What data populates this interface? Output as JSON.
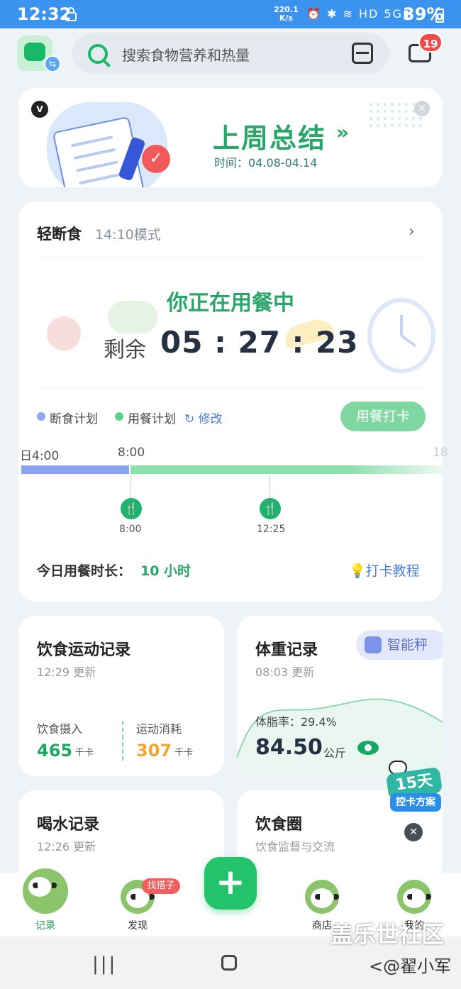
{
  "status": {
    "time": "12:32",
    "speed": "220.1",
    "speed_unit": "K/s",
    "icons": "⏰ ✱ ≋ HD 5G▮",
    "battery": "39%"
  },
  "header": {
    "search_placeholder": "搜索食物营养和热量",
    "mail_badge": "19"
  },
  "summary": {
    "title": "上周总结",
    "arrow": "»",
    "period": "时间：04.08-04.14"
  },
  "fasting": {
    "title": "轻断食",
    "mode": "14:10模式",
    "state": "你正在用餐中",
    "remain_label": "剩余",
    "timer": "05 : 27 : 23",
    "legend_fast": "断食计划",
    "legend_eat": "用餐计划",
    "modify": "修改",
    "checkin_button": "用餐打卡",
    "ticks": [
      "日4:00",
      "8:00",
      "18"
    ],
    "meals": [
      "8:00",
      "12:25"
    ],
    "duration_label": "今日用餐时长：",
    "duration_value": "10 小时",
    "tutorial": "打卡教程"
  },
  "diet": {
    "title": "饮食运动记录",
    "updated": "12:29 更新",
    "intake_label": "饮食摄入",
    "intake_value": "465",
    "intake_unit": "千卡",
    "burn_label": "运动消耗",
    "burn_value": "307",
    "burn_unit": "千卡"
  },
  "weight": {
    "title": "体重记录",
    "updated": "08:03 更新",
    "scale": "智能秤",
    "fat": "体脂率：29.4%",
    "value": "84.50",
    "unit": "公斤"
  },
  "water": {
    "title": "喝水记录",
    "updated": "12:26 更新"
  },
  "circle": {
    "title": "饮食圈",
    "subtitle": "饮食监督与交流"
  },
  "promo": {
    "days": "15天",
    "plan": "控卡方案"
  },
  "nav": {
    "items": [
      "记录",
      "发现",
      "",
      "商店",
      "我的"
    ],
    "tag": "找搭子",
    "plus": "+"
  },
  "watermark": {
    "line1": "盖乐世社区",
    "line2": "<@翟小军"
  },
  "sysnav": {
    "recent": "|||",
    "back": "<"
  }
}
